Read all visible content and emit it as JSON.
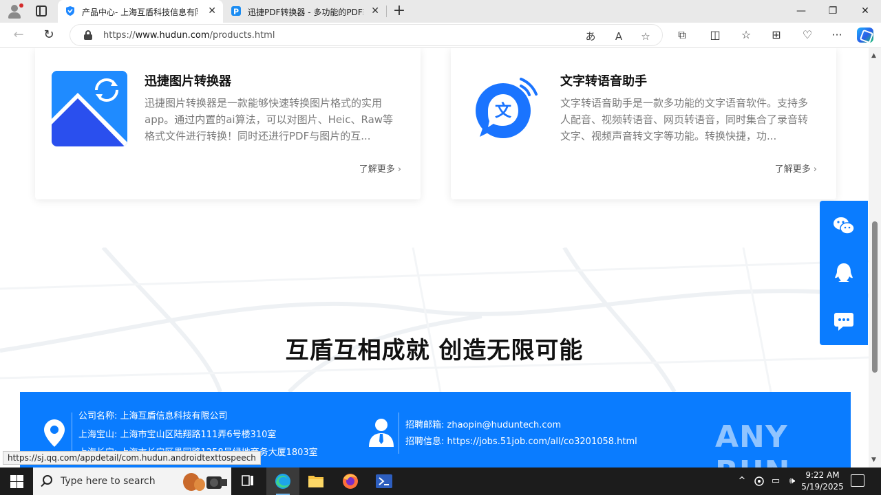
{
  "browser": {
    "tabs": [
      {
        "title": "产品中心- 上海互盾科技信息有限",
        "active": true
      },
      {
        "title": "迅捷PDF转换器 - 多功能的PDF转",
        "active": false
      }
    ],
    "close_glyph": "✕",
    "new_tab_glyph": "+",
    "window_controls": {
      "minimize": "—",
      "maximize": "❐",
      "close": "✕"
    },
    "url_prefix": "https://",
    "url_host": "www.hudun.com",
    "url_path": "/products.html",
    "nav": {
      "back": "←",
      "refresh": "↻"
    },
    "address_icons": {
      "read_aloud_zh": "あ",
      "read_aloud": "A",
      "favorite": "☆"
    },
    "toolbar_icons": {
      "extensions": "⧉",
      "split": "◫",
      "favorites": "☆",
      "collections": "⊞",
      "performance": "♡",
      "menu": "···"
    }
  },
  "page": {
    "products": [
      {
        "name": "迅捷图片转换器",
        "description": "迅捷图片转换器是一款能够快速转换图片格式的实用app。通过内置的ai算法，可以对图片、Heic、Raw等格式文件进行转换！同时还进行PDF与图片的互...",
        "more": "了解更多",
        "icon": "image-convert-icon"
      },
      {
        "name": "文字转语音助手",
        "description": "文字转语音助手是一款多功能的文字语音软件。支持多人配音、视频转语音、网页转语音，同时集合了录音转文字、视频声音转文字等功能。转换快捷，功...",
        "more": "了解更多",
        "icon": "text-to-speech-icon"
      }
    ],
    "more_arrow": "›",
    "slogan": "互盾互相成就 创造无限可能",
    "footer": {
      "company": "公司名称: 上海互盾信息科技有限公司",
      "address_baoshan": "上海宝山: 上海市宝山区陆翔路111弄6号楼310室",
      "address_changning": "上海长宁: 上海市长宁区愚园路1258号绿地商务大厦1803室",
      "email": "招聘邮箱: zhaopin@huduntech.com",
      "jobs": "招聘信息: https://jobs.51job.com/all/co3201058.html",
      "watermark": "ANY RUN"
    }
  },
  "status_url": "https://sj.qq.com/appdetail/com.hudun.androidtexttospeech",
  "scrollbar": {
    "up": "▲",
    "down": "▼"
  },
  "taskbar": {
    "search_placeholder": "Type here to search",
    "time": "9:22 AM",
    "date": "5/19/2025",
    "tray": {
      "chevron": "^",
      "network": "▭",
      "volume": "🕪"
    }
  },
  "colors": {
    "brand_blue": "#0a7cff",
    "taskbar": "#1c1c1c"
  }
}
